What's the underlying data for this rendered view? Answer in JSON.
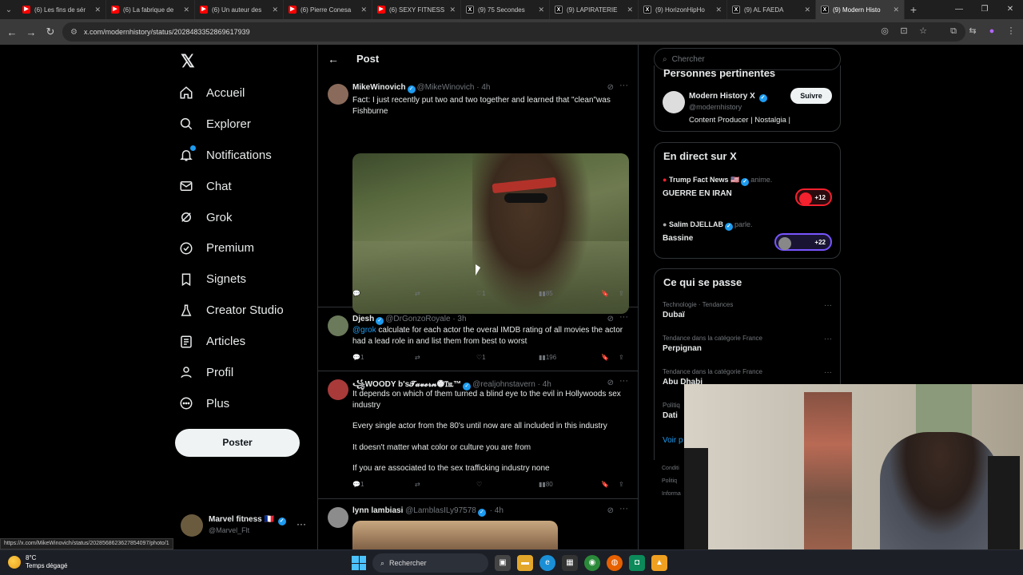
{
  "browser": {
    "tabs": [
      {
        "label": "(6) Les fins de sér",
        "kind": "yt"
      },
      {
        "label": "(6) La fabrique de",
        "kind": "yt"
      },
      {
        "label": "(6) Un auteur des",
        "kind": "yt"
      },
      {
        "label": "(6) Pierre Conesa",
        "kind": "yt"
      },
      {
        "label": "(6) SEXY FITNESS",
        "kind": "yt"
      },
      {
        "label": "(9) 75 Secondes",
        "kind": "x"
      },
      {
        "label": "(9) LAPIRATERIE",
        "kind": "x"
      },
      {
        "label": "(9) HorizonHipHo",
        "kind": "x"
      },
      {
        "label": "(9) AL FAEDA",
        "kind": "x"
      },
      {
        "label": "(9) Modern Histo",
        "kind": "x",
        "active": true
      }
    ],
    "url": "x.com/modernhistory/status/2028483352869617939",
    "status_url": "https://x.com/MikeWinovich/status/2028568623627854097/photo/1"
  },
  "sidebar": {
    "items": [
      {
        "label": "Accueil",
        "icon": "home-icon"
      },
      {
        "label": "Explorer",
        "icon": "search-icon"
      },
      {
        "label": "Notifications",
        "icon": "bell-icon"
      },
      {
        "label": "Chat",
        "icon": "mail-icon"
      },
      {
        "label": "Grok",
        "icon": "grok-icon"
      },
      {
        "label": "Premium",
        "icon": "premium-icon"
      },
      {
        "label": "Signets",
        "icon": "bookmark-icon"
      },
      {
        "label": "Creator Studio",
        "icon": "flask-icon"
      },
      {
        "label": "Articles",
        "icon": "article-icon"
      },
      {
        "label": "Profil",
        "icon": "person-icon"
      },
      {
        "label": "Plus",
        "icon": "more-circle-icon"
      }
    ],
    "post_button": "Poster",
    "account": {
      "name": "Marvel fitness 🇫🇷",
      "handle": "@Marvel_Flt"
    }
  },
  "main": {
    "title": "Post",
    "tweets": [
      {
        "name": "MikeWinovich",
        "handle": "@MikeWinovich",
        "time": "· 4h",
        "text": "Fact: I just recently put two and two together and learned that \"clean\"was Fishburne",
        "replies": "",
        "retweets": "",
        "likes": "1",
        "views": "85"
      },
      {
        "name": "Djesh",
        "handle": "@DrGonzoRoyale",
        "time": "· 3h",
        "mention": "@grok",
        "text": " calculate for each actor the overal IMDB rating of all movies the actor had a lead role in and list them from best to worst",
        "replies": "1",
        "retweets": "",
        "likes": "1",
        "views": "196"
      },
      {
        "name": "꧁WOODY b's𝓣𝓪𝓿𝓮𝓻𝓷🏶℡™",
        "handle": "@realjohnstavern",
        "time": "· 4h",
        "lines": [
          "It depends on which of them turned a blind eye to the evil in Hollywoods sex industry",
          "Every single actor from the 80's until now are all included in this industry",
          "It doesn't matter what color or culture you are from",
          "If you are associated to the sex trafficking industry none"
        ],
        "replies": "1",
        "retweets": "",
        "likes": "",
        "views": "80"
      },
      {
        "name": "lynn lambiasi",
        "handle": "@LamblasILy97578",
        "time": "· 4h"
      }
    ]
  },
  "right": {
    "search_placeholder": "Chercher",
    "relevant": {
      "title": "Personnes pertinentes",
      "name": "Modern History X",
      "handle": "@modernhistory",
      "bio": "Content Producer | Nostalgia |",
      "follow": "Suivre"
    },
    "live": {
      "title": "En direct sur X",
      "items": [
        {
          "host": "Trump Fact News 🇺🇸",
          "suffix": "anime.",
          "title": "GUERRE EN IRAN",
          "count": "+12",
          "color": "#f4212e"
        },
        {
          "host": "Salim DJELLAB",
          "suffix": "parle.",
          "title": "Bassine",
          "count": "+22",
          "color": "#7856ff"
        }
      ]
    },
    "trends": {
      "title": "Ce qui se passe",
      "items": [
        {
          "category": "Technologie · Tendances",
          "name": "Dubaï"
        },
        {
          "category": "Tendance dans la catégorie France",
          "name": "Perpignan"
        },
        {
          "category": "Tendance dans la catégorie France",
          "name": "Abu Dhabi"
        },
        {
          "category": "Politiq",
          "name": "Dati"
        }
      ],
      "more": "Voir p"
    },
    "footer": [
      "Conditi",
      "Politiq",
      "Informa"
    ]
  },
  "taskbar": {
    "temp": "8°C",
    "weather": "Temps dégagé",
    "search": "Rechercher"
  }
}
